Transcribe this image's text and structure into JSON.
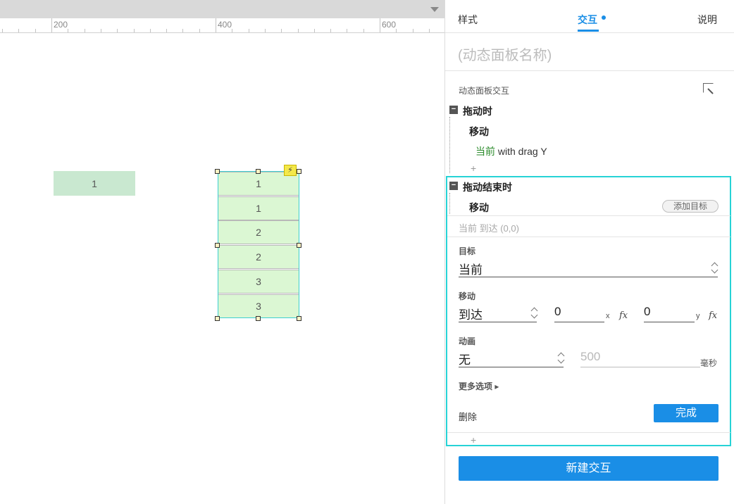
{
  "ruler": {
    "labels": [
      "200",
      "400",
      "600"
    ]
  },
  "canvas": {
    "left_cell": "1",
    "panel_rows": [
      "1",
      "1",
      "2",
      "2",
      "3",
      "3"
    ],
    "event_badge_icon": "lightning-bolt-icon"
  },
  "tabs": [
    {
      "label": "样式"
    },
    {
      "label": "交互"
    },
    {
      "label": "说明"
    }
  ],
  "panel_name_placeholder": "(动态面板名称)",
  "section_label": "动态面板交互",
  "events": [
    {
      "title": "拖动时",
      "action": "移动",
      "target": "当前",
      "detail": "with drag Y"
    },
    {
      "title": "拖动结束时",
      "action": "移动",
      "add_target": "添加目标",
      "summary": "当前 到达 (0,0)"
    }
  ],
  "editor": {
    "target_label": "目标",
    "target_value": "当前",
    "move_label": "移动",
    "move_type": "到达",
    "x_value": "0",
    "x_axis": "x",
    "y_value": "0",
    "y_axis": "y",
    "fx": "fx",
    "anim_label": "动画",
    "anim_value": "无",
    "duration": "500",
    "duration_unit": "毫秒",
    "more_options": "更多选项 ▸",
    "delete": "删除",
    "done": "完成"
  },
  "plus": "+",
  "new_interaction": "新建交互",
  "colors": {
    "accent": "#1a8ee6",
    "highlight": "#27d3d6",
    "panel_row": "#dbf7d3"
  }
}
